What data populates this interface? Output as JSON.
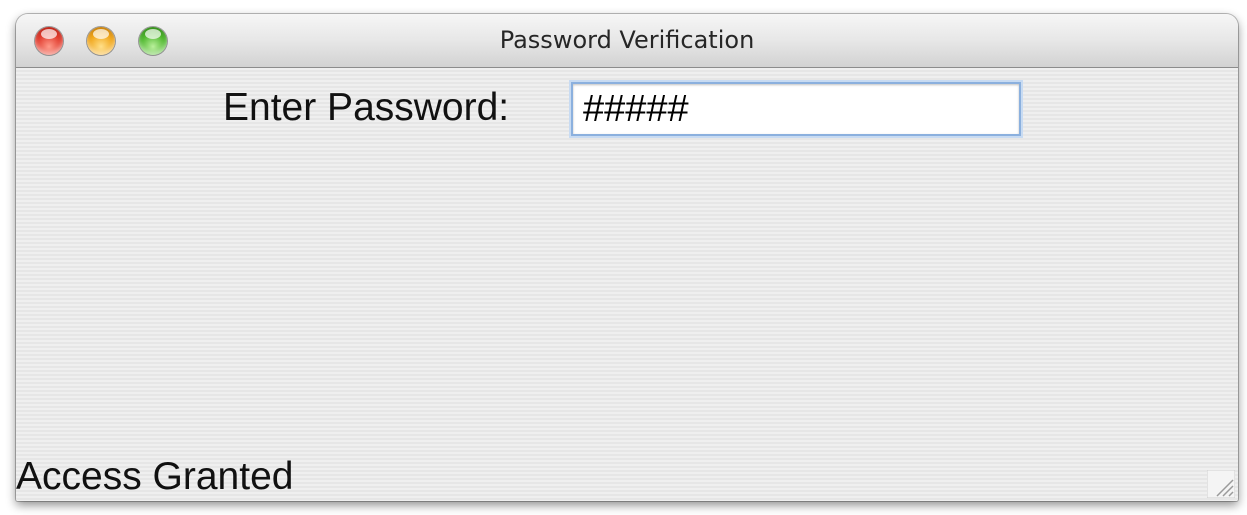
{
  "window": {
    "title": "Password Verification",
    "buttons": [
      "close",
      "minimize",
      "zoom"
    ]
  },
  "form": {
    "password_label": "Enter Password:",
    "password_value": "#####"
  },
  "status": {
    "text": "Access Granted"
  },
  "icons": {
    "close": "close-icon",
    "minimize": "minimize-icon",
    "zoom": "zoom-icon",
    "resize": "resize-grip-icon"
  },
  "colors": {
    "close": "#e0382a",
    "minimize": "#f0a417",
    "zoom": "#4bb52a",
    "focus_ring": "#8bb0de"
  }
}
